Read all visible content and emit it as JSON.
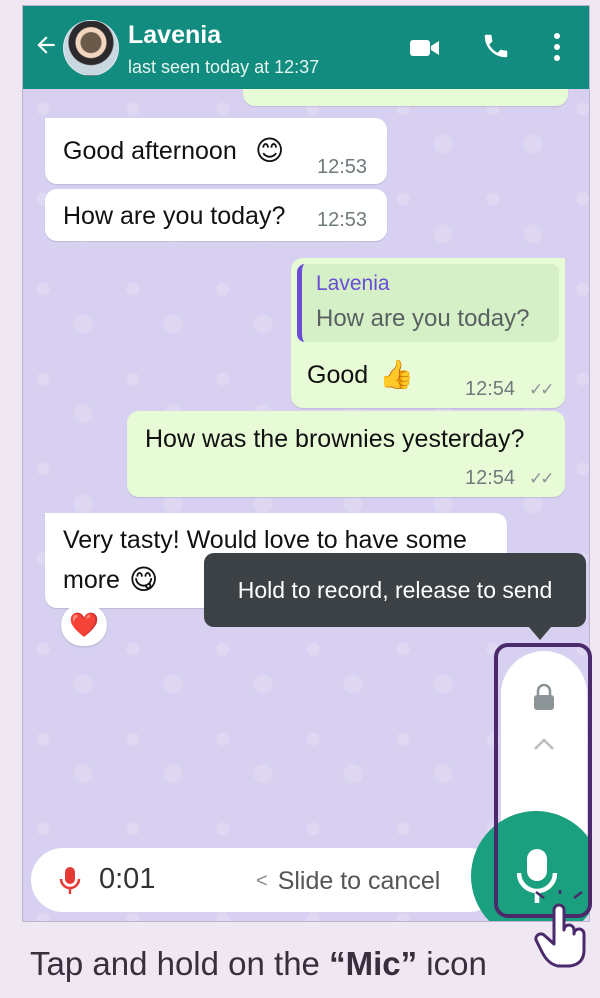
{
  "header": {
    "name": "Lavenia",
    "status": "last seen today at 12:37"
  },
  "messages": [
    {
      "text": "Good afternoon",
      "emoji": "😊",
      "time": "12:53"
    },
    {
      "text": "How are you today?",
      "time": "12:53"
    },
    {
      "quote_author": "Lavenia",
      "quote_text": "How are you today?",
      "text": "Good",
      "emoji": "👍",
      "time": "12:54",
      "ticks": "✓✓"
    },
    {
      "text": "How was the brownies yesterday?",
      "time": "12:54",
      "ticks": "✓✓"
    },
    {
      "text_line1": "Very tasty! Would love to have some",
      "text_line2": "more",
      "emoji": "😋",
      "reaction": "❤️"
    }
  ],
  "tooltip": "Hold to record, release to send",
  "recording": {
    "elapsed": "0:01",
    "slide_text": "Slide to cancel",
    "slide_chevron": "<"
  },
  "caption": {
    "before": "Tap and hold on the ",
    "bold": "“Mic”",
    "after": " icon"
  },
  "colors": {
    "header": "#128c7e",
    "outgoing_bubble": "#e7fcd6",
    "mic_button": "#1aa07f",
    "record_dot": "#e53935",
    "highlight_border": "#4b2a6b",
    "quote_bar": "#6a4cd6"
  },
  "icons": [
    "back-arrow-icon",
    "video-call-icon",
    "phone-icon",
    "more-vert-icon",
    "lock-icon",
    "chevron-up-icon",
    "mic-icon",
    "hand-pointer-icon"
  ]
}
